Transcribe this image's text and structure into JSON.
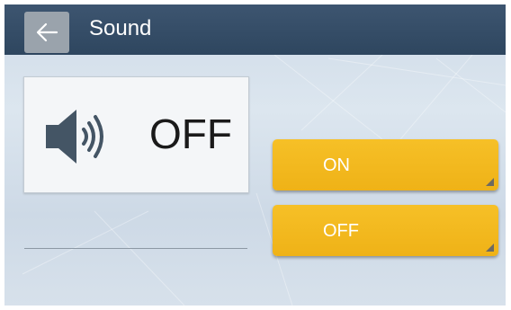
{
  "header": {
    "title": "Sound",
    "back_icon": "arrow-left-icon"
  },
  "status": {
    "icon": "speaker-icon",
    "value": "OFF"
  },
  "buttons": {
    "on_label": "ON",
    "off_label": "OFF"
  },
  "colors": {
    "topbar": "#344d67",
    "button": "#f2b81f",
    "button_text": "#ffffff"
  }
}
